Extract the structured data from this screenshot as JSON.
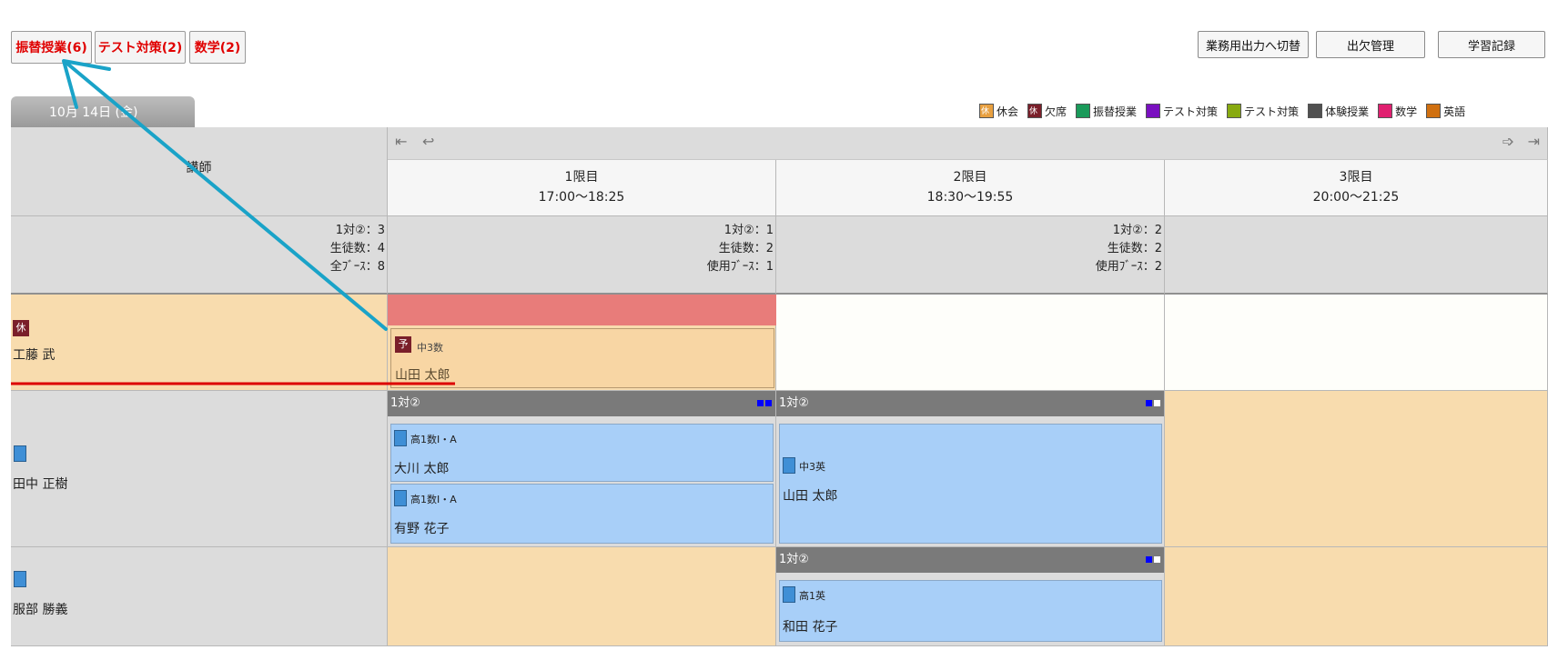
{
  "top_buttons": [
    {
      "label": "振替授業(6)"
    },
    {
      "label": "テスト対策(2)"
    },
    {
      "label": "数学(2)"
    }
  ],
  "right_buttons": [
    {
      "label": "業務用出力へ切替"
    },
    {
      "label": "出欠管理"
    },
    {
      "label": "学習記録"
    }
  ],
  "date_tab": "10月 14日 (金)",
  "legend": [
    {
      "label": "休会",
      "color": "#e8a040",
      "mark": "休"
    },
    {
      "label": "欠席",
      "color": "#7a1f2a",
      "mark": "休"
    },
    {
      "label": "振替授業",
      "color": "#1a9a5a",
      "mark": ""
    },
    {
      "label": "テスト対策",
      "color": "#7a10c0",
      "mark": ""
    },
    {
      "label": "テスト対策",
      "color": "#88aa10",
      "mark": ""
    },
    {
      "label": "体験授業",
      "color": "#505050",
      "mark": ""
    },
    {
      "label": "数学",
      "color": "#e02070",
      "mark": ""
    },
    {
      "label": "英語",
      "color": "#d07010",
      "mark": ""
    }
  ],
  "grid": {
    "corner_label": "講師",
    "periods": [
      {
        "name": "1限目",
        "time": "17:00～18:25",
        "stats": [
          "1対②：1",
          "生徒数：2",
          "使用ﾌﾞｰｽ：1"
        ]
      },
      {
        "name": "2限目",
        "time": "18:30～19:55",
        "stats": [
          "1対②：2",
          "生徒数：2",
          "使用ﾌﾞｰｽ：2"
        ]
      },
      {
        "name": "3限目",
        "time": "20:00～21:25",
        "stats": []
      }
    ],
    "total_stats": [
      "1対②：3",
      "生徒数：4",
      "全ﾌﾞｰｽ：8"
    ]
  },
  "teachers": [
    {
      "name": "工藤 武",
      "badge": "休"
    },
    {
      "name": "田中 正樹",
      "badge": ""
    },
    {
      "name": "服部 勝義",
      "badge": ""
    }
  ],
  "kudo_slot": {
    "badge": "予",
    "subject": "中3数",
    "student": "山田 太郎"
  },
  "tanaka_p1": {
    "group": "1対②",
    "entries": [
      {
        "subject": "高1数Ⅰ・A",
        "student": "大川 太郎"
      },
      {
        "subject": "高1数Ⅰ・A",
        "student": "有野 花子"
      }
    ]
  },
  "tanaka_p2": {
    "group": "1対②",
    "subject": "中3英",
    "student": "山田 太郎"
  },
  "hattori_p2": {
    "group": "1対②",
    "subject": "高1英",
    "student": "和田 花子"
  },
  "colors": {
    "accent_red": "#e00000",
    "arrow": "#1aa3c8",
    "underline": "#dd0000"
  }
}
